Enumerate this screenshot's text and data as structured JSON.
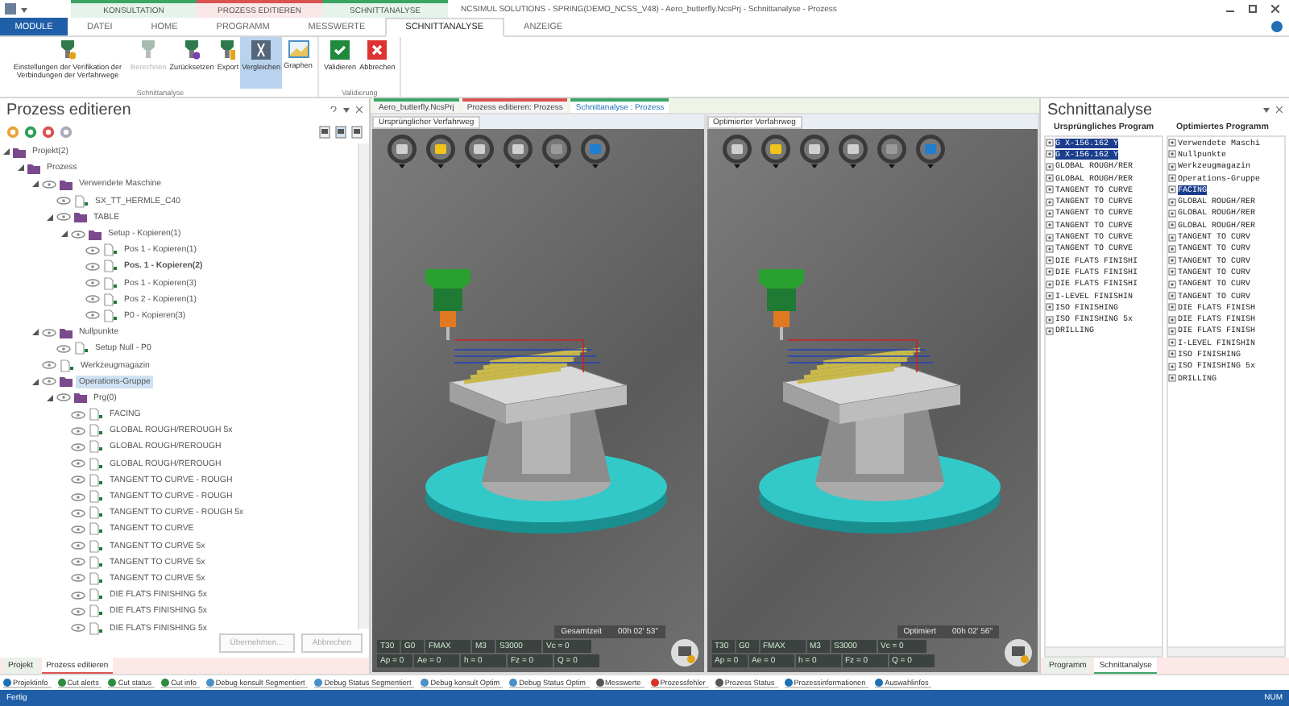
{
  "window": {
    "title": "NCSIMUL SOLUTIONS - SPRING(DEMO_NCSS_V48) - Aero_butterfly.NcsPrj - Schnittanalyse - Prozess"
  },
  "context_groups": [
    {
      "label": "KONSULTATION",
      "color": "#3aa564"
    },
    {
      "label": "PROZESS EDITIEREN",
      "color": "#d9534f"
    },
    {
      "label": "SCHNITTANALYSE",
      "color": "#3aa564"
    }
  ],
  "ribbon_tabs": [
    {
      "label": "MODULE",
      "kind": "module",
      "selected": false
    },
    {
      "label": "DATEI",
      "kind": "tab",
      "selected": false
    },
    {
      "label": "HOME",
      "kind": "tab",
      "selected": false
    },
    {
      "label": "PROGRAMM",
      "kind": "tab",
      "selected": false
    },
    {
      "label": "MESSWERTE",
      "kind": "tab",
      "selected": false
    },
    {
      "label": "SCHNITTANALYSE",
      "kind": "tab",
      "selected": true
    },
    {
      "label": "ANZEIGE",
      "kind": "tab",
      "selected": false
    }
  ],
  "ribbon_groups": [
    {
      "label": "Schnittanalyse",
      "buttons": [
        {
          "label": "Einstellungen der Verifikation der Verbindungen der Verfahrwege",
          "kind": "settings",
          "disabled": false,
          "selected": false
        },
        {
          "label": "Berechnen",
          "kind": "calc",
          "disabled": true,
          "selected": false
        },
        {
          "label": "Zurücksetzen",
          "kind": "reset",
          "disabled": false,
          "selected": false
        },
        {
          "label": "Export",
          "kind": "export",
          "disabled": false,
          "selected": false
        },
        {
          "label": "Vergleichen",
          "kind": "compare",
          "disabled": false,
          "selected": true
        },
        {
          "label": "Graphen",
          "kind": "graph",
          "disabled": false,
          "selected": false
        }
      ]
    },
    {
      "label": "Validierung",
      "buttons": [
        {
          "label": "Validieren",
          "kind": "ok",
          "disabled": false,
          "selected": false
        },
        {
          "label": "Abbrechen",
          "kind": "cancel",
          "disabled": false,
          "selected": false
        }
      ]
    }
  ],
  "left_panel": {
    "title": "Prozess editieren",
    "tree": [
      {
        "label": "Projekt(2)",
        "selected": false,
        "active": false,
        "children": [
          {
            "label": "Prozess",
            "selected": false,
            "active": false,
            "children": [
              {
                "label": "Verwendete Maschine",
                "selected": false,
                "active": false,
                "children": [
                  {
                    "label": "SX_TT_HERMLE_C40",
                    "selected": false,
                    "active": false
                  },
                  {
                    "label": "TABLE",
                    "selected": false,
                    "active": false,
                    "children": [
                      {
                        "label": "Setup - Kopieren(1)",
                        "selected": false,
                        "active": false,
                        "children": [
                          {
                            "label": "Pos 1 - Kopieren(1)",
                            "selected": false,
                            "active": false
                          },
                          {
                            "label": "Pos. 1 - Kopieren(2)",
                            "selected": false,
                            "active": true
                          },
                          {
                            "label": "Pos 1 - Kopieren(3)",
                            "selected": false,
                            "active": false
                          },
                          {
                            "label": "Pos 2 - Kopieren(1)",
                            "selected": false,
                            "active": false
                          },
                          {
                            "label": "P0 - Kopieren(3)",
                            "selected": false,
                            "active": false
                          }
                        ]
                      }
                    ]
                  }
                ]
              },
              {
                "label": "Nullpunkte",
                "selected": false,
                "active": false,
                "children": [
                  {
                    "label": "Setup Null - P0",
                    "selected": false,
                    "active": false
                  }
                ]
              },
              {
                "label": "Werkzeugmagazin",
                "selected": false,
                "active": false
              },
              {
                "label": "Operations-Gruppe",
                "selected": true,
                "active": false,
                "children": [
                  {
                    "label": "Prg(0)",
                    "selected": false,
                    "active": false,
                    "children": [
                      {
                        "label": "FACING",
                        "selected": false,
                        "active": false
                      },
                      {
                        "label": "GLOBAL ROUGH/REROUGH 5x",
                        "selected": false,
                        "active": false
                      },
                      {
                        "label": "GLOBAL ROUGH/REROUGH",
                        "selected": false,
                        "active": false
                      },
                      {
                        "label": "GLOBAL ROUGH/REROUGH",
                        "selected": false,
                        "active": false
                      },
                      {
                        "label": "TANGENT TO CURVE - ROUGH",
                        "selected": false,
                        "active": false
                      },
                      {
                        "label": "TANGENT TO CURVE - ROUGH",
                        "selected": false,
                        "active": false
                      },
                      {
                        "label": "TANGENT TO CURVE - ROUGH 5x",
                        "selected": false,
                        "active": false
                      },
                      {
                        "label": "TANGENT TO CURVE",
                        "selected": false,
                        "active": false
                      },
                      {
                        "label": "TANGENT TO CURVE 5x",
                        "selected": false,
                        "active": false
                      },
                      {
                        "label": "TANGENT TO CURVE 5x",
                        "selected": false,
                        "active": false
                      },
                      {
                        "label": "TANGENT TO CURVE 5x",
                        "selected": false,
                        "active": false
                      },
                      {
                        "label": "DIE FLATS FINISHING 5x",
                        "selected": false,
                        "active": false
                      },
                      {
                        "label": "DIE FLATS FINISHING 5x",
                        "selected": false,
                        "active": false
                      },
                      {
                        "label": "DIE FLATS FINISHING 5x",
                        "selected": false,
                        "active": false
                      }
                    ]
                  }
                ]
              }
            ]
          }
        ]
      }
    ],
    "buttons": [
      {
        "label": "Übernehmen...",
        "disabled": true
      },
      {
        "label": "Abbrechen",
        "disabled": true
      }
    ],
    "bottom_tabs": [
      {
        "label": "Projekt",
        "selected": false
      },
      {
        "label": "Prozess editieren",
        "selected": true
      }
    ]
  },
  "document_tabs": [
    {
      "label": "Aero_butterfly.NcsPrj",
      "color": "#3aa564",
      "selected": false
    },
    {
      "label": "Prozess editieren: Prozess",
      "color": "#d9534f",
      "selected": false
    },
    {
      "label": "Schnittanalyse : Prozess",
      "color": "#3aa564",
      "selected": true
    }
  ],
  "viewports": [
    {
      "title": "Ursprünglicher Verfahrweg",
      "time_label": "Gesamtzeit",
      "time": "00h 02' 53\"",
      "row_1": [
        "T30",
        "G0",
        "FMAX",
        "M3",
        "S3000",
        "Vc = 0"
      ],
      "row_2": [
        "Ap = 0",
        "Ae = 0",
        "h = 0",
        "Fz = 0",
        "Q = 0"
      ]
    },
    {
      "title": "Optimierter Verfahrweg",
      "time_label": "Optimiert",
      "time": "00h 02' 56\"",
      "row_1": [
        "T30",
        "G0",
        "FMAX",
        "M3",
        "S3000",
        "Vc = 0"
      ],
      "row_2": [
        "Ap = 0",
        "Ae = 0",
        "h = 0",
        "Fz = 0",
        "Q = 0"
      ]
    }
  ],
  "right_panel": {
    "title": "Schnittanalyse",
    "columns": [
      {
        "header": "Ursprüngliches Program",
        "lines": [
          {
            "text": "G X-156.162 Y",
            "selected": true
          },
          {
            "text": "G X-156.162 Y",
            "selected": true
          },
          {
            "text": "GLOBAL ROUGH/RER",
            "selected": false
          },
          {
            "text": "GLOBAL ROUGH/RER",
            "selected": false
          },
          {
            "text": "TANGENT TO CURVE",
            "selected": false
          },
          {
            "text": "TANGENT TO CURVE",
            "selected": false
          },
          {
            "text": "TANGENT TO CURVE",
            "selected": false
          },
          {
            "text": "TANGENT TO CURVE",
            "selected": false
          },
          {
            "text": "TANGENT TO CURVE",
            "selected": false
          },
          {
            "text": "TANGENT TO CURVE",
            "selected": false
          },
          {
            "text": "DIE FLATS FINISHI",
            "selected": false
          },
          {
            "text": "DIE FLATS FINISHI",
            "selected": false
          },
          {
            "text": "DIE FLATS FINISHI",
            "selected": false
          },
          {
            "text": "I-LEVEL FINISHIN",
            "selected": false
          },
          {
            "text": "ISO FINISHING",
            "selected": false
          },
          {
            "text": "ISO FINISHING 5x",
            "selected": false
          },
          {
            "text": "DRILLING",
            "selected": false
          }
        ]
      },
      {
        "header": "Optimiertes Programm",
        "lines": [
          {
            "text": "Verwendete Maschi",
            "selected": false
          },
          {
            "text": "Nullpunkte",
            "selected": false
          },
          {
            "text": "Werkzeugmagazin",
            "selected": false
          },
          {
            "text": "Operations-Gruppe",
            "selected": false
          },
          {
            "text": "FACING",
            "selected": true
          },
          {
            "text": "GLOBAL ROUGH/RER",
            "selected": false
          },
          {
            "text": "GLOBAL ROUGH/RER",
            "selected": false
          },
          {
            "text": "GLOBAL ROUGH/RER",
            "selected": false
          },
          {
            "text": "TANGENT TO CURV",
            "selected": false
          },
          {
            "text": "TANGENT TO CURV",
            "selected": false
          },
          {
            "text": "TANGENT TO CURV",
            "selected": false
          },
          {
            "text": "TANGENT TO CURV",
            "selected": false
          },
          {
            "text": "TANGENT TO CURV",
            "selected": false
          },
          {
            "text": "TANGENT TO CURV",
            "selected": false
          },
          {
            "text": "DIE FLATS FINISH",
            "selected": false
          },
          {
            "text": "DIE FLATS FINISH",
            "selected": false
          },
          {
            "text": "DIE FLATS FINISH",
            "selected": false
          },
          {
            "text": "I-LEVEL FINISHIN",
            "selected": false
          },
          {
            "text": "ISO FINISHING",
            "selected": false
          },
          {
            "text": "ISO FINISHING 5x",
            "selected": false
          },
          {
            "text": "DRILLING",
            "selected": false
          }
        ]
      }
    ],
    "bottom_tabs": [
      {
        "label": "Programm",
        "selected": false
      },
      {
        "label": "Schnittanalyse",
        "selected": true
      }
    ]
  },
  "output_tabs": [
    {
      "label": "Projektinfo",
      "color": "#1f6fb5"
    },
    {
      "label": "Cut alerts",
      "color": "#2e8b3d"
    },
    {
      "label": "Cut status",
      "color": "#2e8b3d"
    },
    {
      "label": "Cut info",
      "color": "#2e8b3d"
    },
    {
      "label": "Debug konsult Segmentiert",
      "color": "#4a90c8"
    },
    {
      "label": "Debug Status Segmentiert",
      "color": "#4a90c8"
    },
    {
      "label": "Debug konsult Optim",
      "color": "#4a90c8"
    },
    {
      "label": "Debug Status Optim",
      "color": "#4a90c8"
    },
    {
      "label": "Messwerte",
      "color": "#555555"
    },
    {
      "label": "Prozessfehler",
      "color": "#d9342b"
    },
    {
      "label": "Prozess Status",
      "color": "#555555"
    },
    {
      "label": "Prozessinformationen",
      "color": "#1f6fb5"
    },
    {
      "label": "Auswahlinfos",
      "color": "#1f6fb5"
    }
  ],
  "status_bar": {
    "text": "Fertig",
    "indicator": "NUM"
  }
}
